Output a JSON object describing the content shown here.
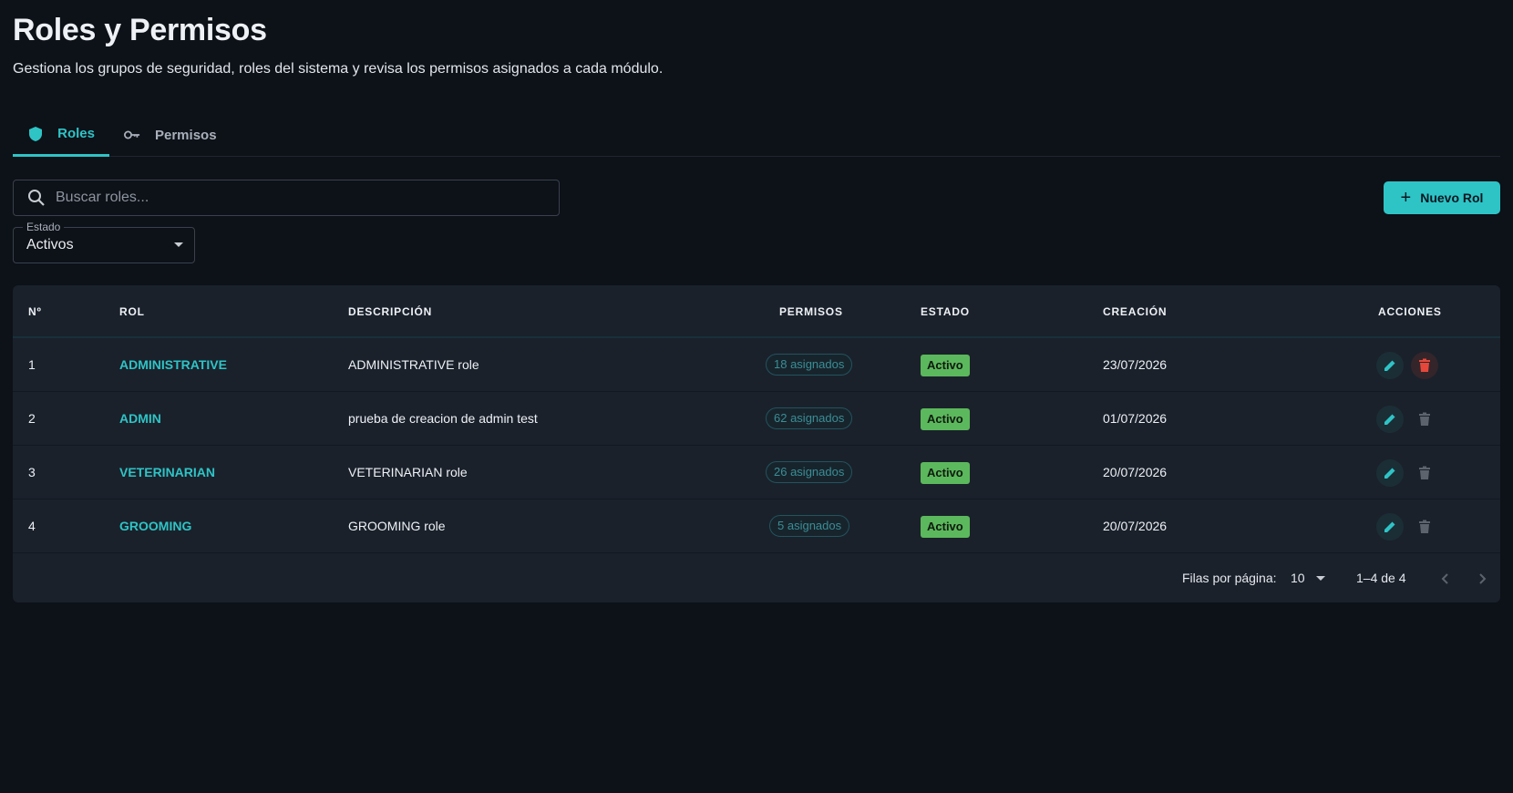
{
  "header": {
    "title": "Roles y Permisos",
    "subtitle": "Gestiona los grupos de seguridad, roles del sistema y revisa los permisos asignados a cada módulo."
  },
  "tabs": [
    {
      "label": "Roles",
      "icon": "shield-icon",
      "active": true
    },
    {
      "label": "Permisos",
      "icon": "key-icon",
      "active": false
    }
  ],
  "search": {
    "placeholder": "Buscar roles...",
    "value": ""
  },
  "filter": {
    "label": "Estado",
    "value": "Activos"
  },
  "new_button": {
    "label": "Nuevo Rol"
  },
  "table": {
    "columns": {
      "num": "Nº",
      "rol": "ROL",
      "descripcion": "DESCRIPCIÓN",
      "permisos": "PERMISOS",
      "estado": "ESTADO",
      "creacion": "CREACIÓN",
      "acciones": "ACCIONES"
    },
    "rows": [
      {
        "num": "1",
        "rol": "ADMINISTRATIVE",
        "descripcion": "ADMINISTRATIVE role",
        "permisos": "18 asignados",
        "estado": "Activo",
        "creacion": "23/07/2026",
        "delete_enabled": true
      },
      {
        "num": "2",
        "rol": "ADMIN",
        "descripcion": "prueba de creacion de admin test",
        "permisos": "62 asignados",
        "estado": "Activo",
        "creacion": "01/07/2026",
        "delete_enabled": false
      },
      {
        "num": "3",
        "rol": "VETERINARIAN",
        "descripcion": "VETERINARIAN role",
        "permisos": "26 asignados",
        "estado": "Activo",
        "creacion": "20/07/2026",
        "delete_enabled": false
      },
      {
        "num": "4",
        "rol": "GROOMING",
        "descripcion": "GROOMING role",
        "permisos": "5 asignados",
        "estado": "Activo",
        "creacion": "20/07/2026",
        "delete_enabled": false
      }
    ]
  },
  "pagination": {
    "rows_per_page_label": "Filas por página:",
    "rows_per_page": "10",
    "range": "1–4 de 4"
  },
  "colors": {
    "accent": "#2ec4c6",
    "status_active": "#5cb85c",
    "delete_active": "#e5483b",
    "background": "#0d1118"
  }
}
